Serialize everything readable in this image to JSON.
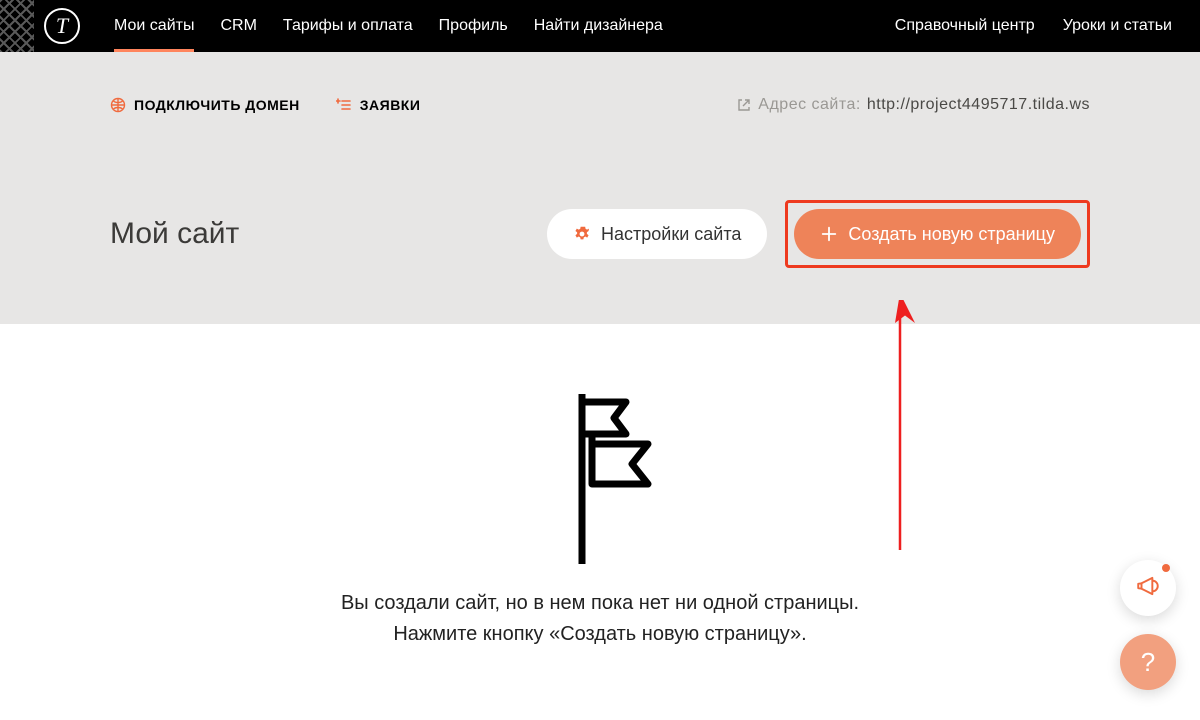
{
  "nav": {
    "logo_letter": "T",
    "items": [
      {
        "label": "Мои сайты",
        "active": true
      },
      {
        "label": "CRM"
      },
      {
        "label": "Тарифы и оплата"
      },
      {
        "label": "Профиль"
      },
      {
        "label": "Найти дизайнера"
      }
    ],
    "right": [
      {
        "label": "Справочный центр"
      },
      {
        "label": "Уроки и статьи"
      }
    ]
  },
  "toolbar": {
    "connect_domain": "ПОДКЛЮЧИТЬ ДОМЕН",
    "requests": "ЗАЯВКИ",
    "site_address_label": "Адрес сайта:",
    "site_address_value": "http://project4495717.tilda.ws"
  },
  "page": {
    "title": "Мой сайт",
    "settings_button": "Настройки сайта",
    "create_page_button": "Создать новую страницу"
  },
  "empty_state": {
    "line1": "Вы создали сайт, но в нем пока нет ни одной страницы.",
    "line2": "Нажмите кнопку «Создать новую страницу»."
  },
  "fab": {
    "help": "?"
  },
  "colors": {
    "accent": "#f06a3e",
    "highlight_border": "#ee3a1f"
  }
}
